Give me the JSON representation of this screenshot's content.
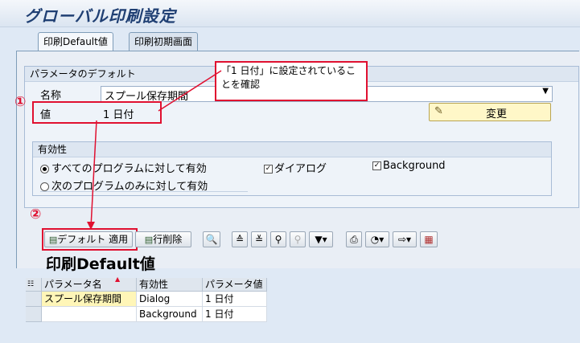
{
  "window": {
    "title": "グローバル印刷設定"
  },
  "tabs": [
    {
      "label": "印刷Default値"
    },
    {
      "label": "印刷初期画面"
    }
  ],
  "param_group": {
    "title": "パラメータのデフォルト",
    "name_label": "名称",
    "name_value": "スプール保存期間",
    "value_label": "値",
    "value_value": "1 日付",
    "change_button": "変更"
  },
  "validity_group": {
    "title": "有効性",
    "radio_all": "すべてのプログラムに対して有効",
    "radio_next": "次のプログラムのみに対して有効",
    "check_dialog": "ダイアログ",
    "check_background": "Background"
  },
  "annotation": {
    "callout": "「1 日付」に設定されていることを確認",
    "marker1": "①",
    "marker2": "②",
    "color": "#e01030"
  },
  "toolbar": {
    "apply_default": "デフォルト 適用",
    "delete_row": "行削除"
  },
  "section_title": "印刷Default値",
  "table": {
    "headers": [
      "パラメータ名",
      "有効性",
      "パラメータ値"
    ],
    "rows": [
      {
        "name": "スプール保存期間",
        "validity": "Dialog",
        "value": "1 日付"
      },
      {
        "name": "",
        "validity": "Background",
        "value": "1 日付"
      }
    ]
  }
}
